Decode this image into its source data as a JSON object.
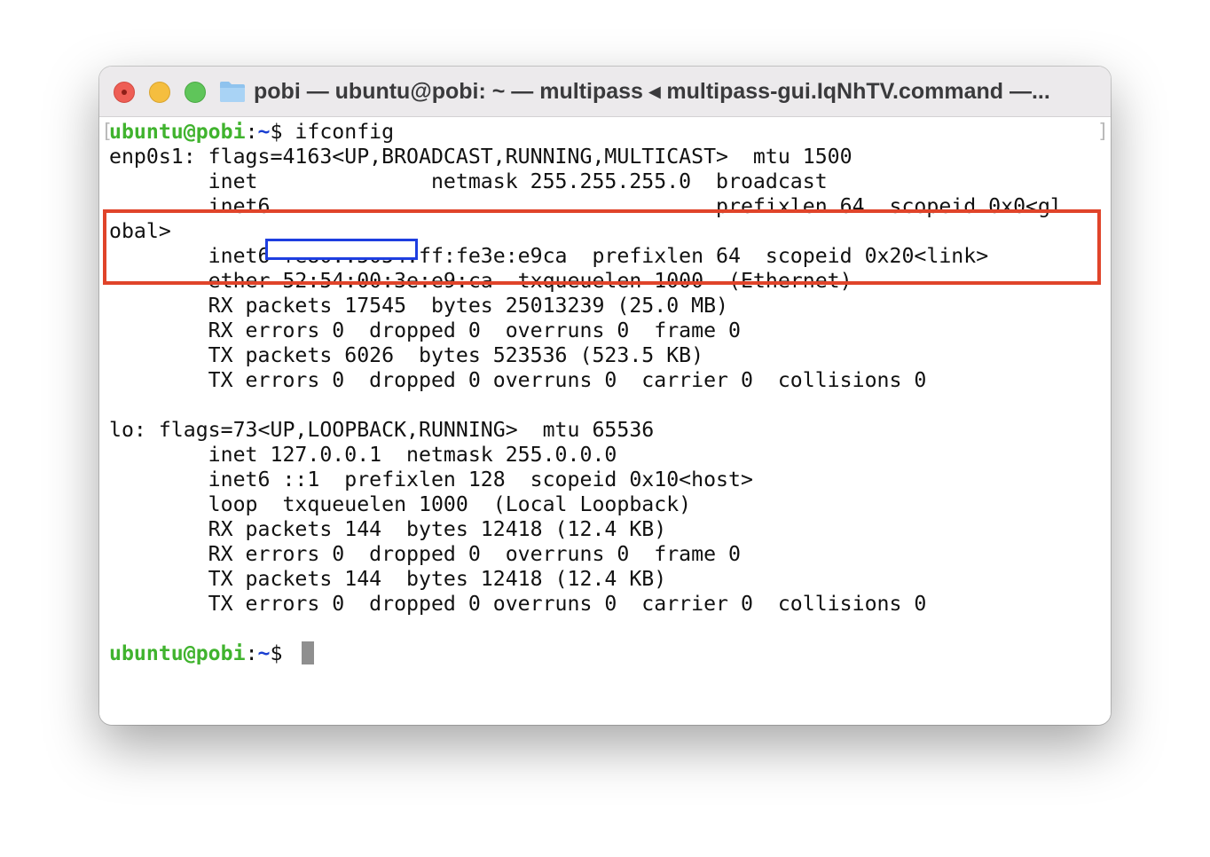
{
  "window": {
    "title": "pobi — ubuntu@pobi: ~ — multipass ◂ multipass-gui.IqNhTV.command —...",
    "folder_icon": "folder-icon",
    "buttons": [
      "close",
      "minimize",
      "zoom"
    ]
  },
  "terminal": {
    "prompt_user": "ubuntu@pobi",
    "prompt_sep": ":",
    "prompt_dir": "~",
    "prompt_dollar": "$ ",
    "command": "ifconfig",
    "lines": [
      "enp0s1: flags=4163<UP,BROADCAST,RUNNING,MULTICAST>  mtu 1500",
      "        inet              netmask 255.255.255.0  broadcast",
      "        inet6                                    prefixlen 64  scopeid 0x0<gl",
      "obal>",
      "        inet6 fe80::5054:ff:fe3e:e9ca  prefixlen 64  scopeid 0x20<link>",
      "        ether 52:54:00:3e:e9:ca  txqueuelen 1000  (Ethernet)",
      "        RX packets 17545  bytes 25013239 (25.0 MB)",
      "        RX errors 0  dropped 0  overruns 0  frame 0",
      "        TX packets 6026  bytes 523536 (523.5 KB)",
      "        TX errors 0  dropped 0 overruns 0  carrier 0  collisions 0",
      "",
      "lo: flags=73<UP,LOOPBACK,RUNNING>  mtu 65536",
      "        inet 127.0.0.1  netmask 255.0.0.0",
      "        inet6 ::1  prefixlen 128  scopeid 0x10<host>",
      "        loop  txqueuelen 1000  (Local Loopback)",
      "        RX packets 144  bytes 12418 (12.4 KB)",
      "        RX errors 0  dropped 0  overruns 0  frame 0",
      "        TX packets 144  bytes 12418 (12.4 KB)",
      "        TX errors 0  dropped 0 overruns 0  carrier 0  collisions 0",
      ""
    ]
  },
  "colors": {
    "prompt_green": "#40b32e",
    "highlight_red": "#e0442a",
    "highlight_blue": "#1e3ee0"
  }
}
